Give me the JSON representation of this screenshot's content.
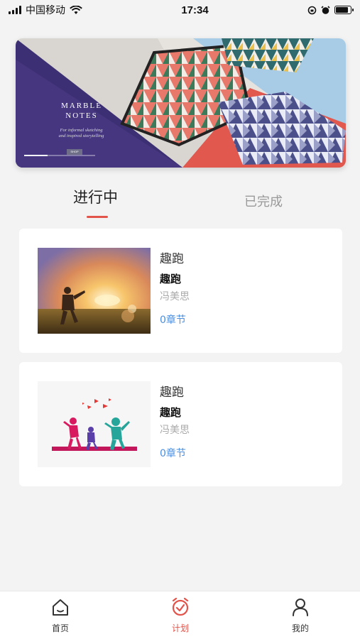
{
  "status_bar": {
    "carrier": "中国移动",
    "time": "17:34"
  },
  "banner": {
    "title_line1": "MARBLE",
    "title_line2": "NOTES",
    "subtitle_line1": "For informal sketching",
    "subtitle_line2": "and inspired storytelling",
    "shop_label": "SHOP",
    "slide_progress": 0.33
  },
  "tabs": {
    "in_progress": "进行中",
    "completed": "已完成"
  },
  "courses": [
    {
      "title": "趣跑",
      "subtitle": "趣跑",
      "author": "冯美思",
      "chapters": "0章节"
    },
    {
      "title": "趣跑",
      "subtitle": "趣跑",
      "author": "冯美思",
      "chapters": "0章节"
    }
  ],
  "bottom_nav": {
    "home": "首页",
    "plan": "计划",
    "mine": "我的"
  },
  "colors": {
    "accent": "#e2534a",
    "link": "#4a8fe0"
  }
}
